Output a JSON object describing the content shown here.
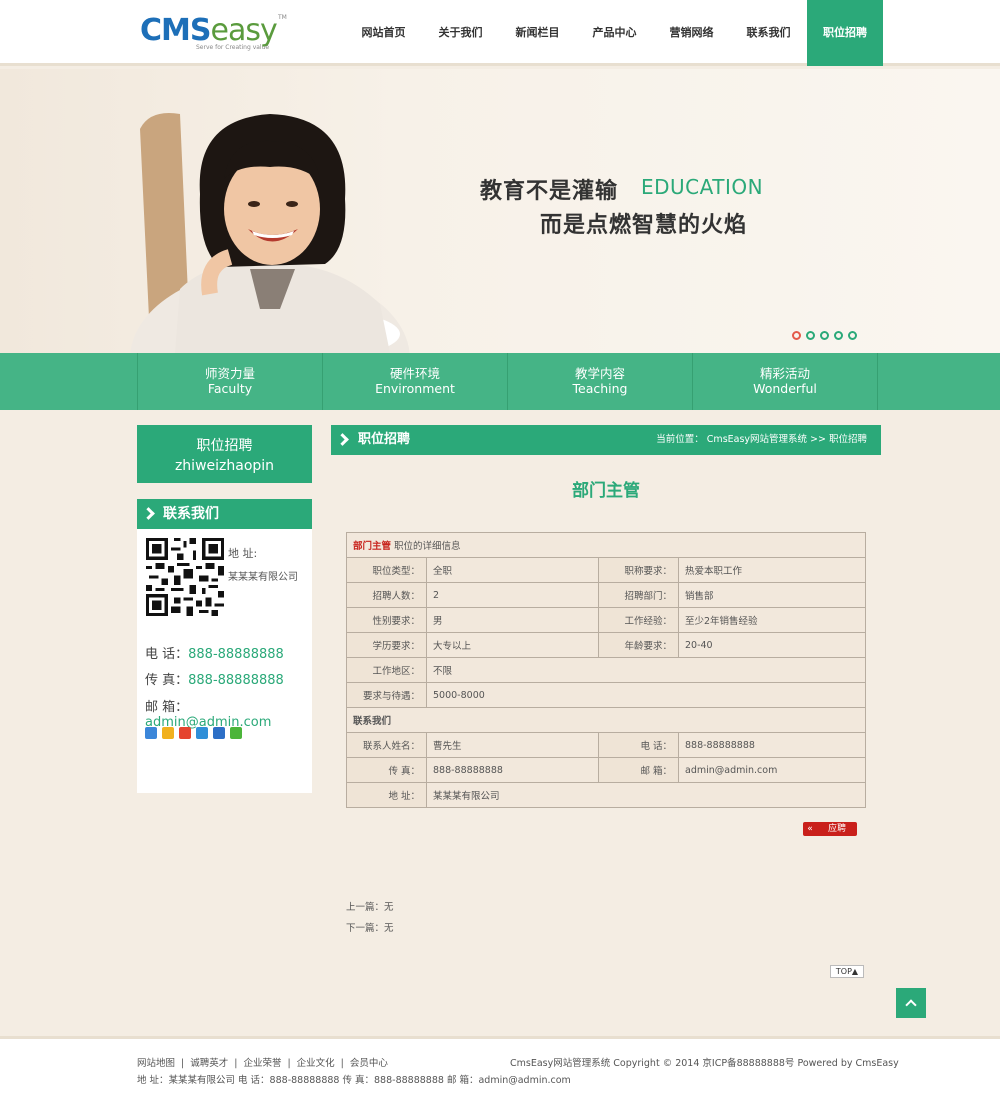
{
  "logo": {
    "cms": "CMS",
    "easy": "easy",
    "tm": "TM",
    "slogan": "Serve for Creating value"
  },
  "nav": [
    "网站首页",
    "关于我们",
    "新闻栏目",
    "产品中心",
    "营销网络",
    "联系我们",
    "职位招聘"
  ],
  "banner": {
    "line1": "教育不是灌输",
    "edu": "EDUCATION",
    "line2": "而是点燃智慧的火焰",
    "slides": 5,
    "active_slide": 1
  },
  "features": [
    {
      "cn": "师资力量",
      "en": "Faculty"
    },
    {
      "cn": "硬件环境",
      "en": "Environment"
    },
    {
      "cn": "教学内容",
      "en": "Teaching"
    },
    {
      "cn": "精彩活动",
      "en": "Wonderful"
    }
  ],
  "sidebar": {
    "cat_cn": "职位招聘",
    "cat_en": "zhiweizhaopin",
    "contact_title": "联系我们",
    "addr_label": "地 址:",
    "addr_value": "某某某有限公司",
    "phone_label": "电 话：",
    "phone": "888-88888888",
    "fax_label": "传 真：",
    "fax": "888-88888888",
    "email_label": "邮 箱：",
    "email": "admin@admin.com"
  },
  "main": {
    "title": "职位招聘",
    "crumb": "当前位置： CmsEasy网站管理系统  >>  职位招聘",
    "job_title": "部门主管",
    "detail_name": "部门主管",
    "detail_suffix": "职位的详细信息",
    "rows": [
      {
        "k1": "职位类型：",
        "v1": "全职",
        "k2": "职称要求：",
        "v2": "热爱本职工作"
      },
      {
        "k1": "招聘人数：",
        "v1": "2",
        "k2": "招聘部门：",
        "v2": "销售部"
      },
      {
        "k1": "性别要求：",
        "v1": "男",
        "k2": "工作经验：",
        "v2": "至少2年销售经验"
      },
      {
        "k1": "学历要求：",
        "v1": "大专以上",
        "k2": "年龄要求：",
        "v2": "20-40"
      }
    ],
    "area_k": "工作地区：",
    "area_v": "不限",
    "salary_k": "要求与待遇：",
    "salary_v": "5000-8000",
    "contact_section": "联系我们",
    "c_rows": [
      {
        "k1": "联系人姓名：",
        "v1": "曹先生",
        "k2": "电 话：",
        "v2": "888-88888888"
      },
      {
        "k1": "传 真：",
        "v1": "888-88888888",
        "k2": "邮 箱：",
        "v2": "admin@admin.com"
      }
    ],
    "c_addr_k": "地 址：",
    "c_addr_v": "某某某有限公司",
    "apply_arrow": "«",
    "apply_label": "应聘",
    "prev": "上一篇：无",
    "next": "下一篇：无",
    "top_label": "TOP▲"
  },
  "footer": {
    "links": [
      "网站地图",
      "诚聘英才",
      "企业荣誉",
      "企业文化",
      "会员中心"
    ],
    "sep": "|",
    "right": "CmsEasy网站管理系统  Copyright © 2014  京ICP备88888888号  Powered by CmsEasy",
    "addr": "地 址：某某某有限公司  电 话：888-88888888  传 真：888-88888888  邮 箱：admin@admin.com"
  },
  "colors": {
    "accent": "#2ba979",
    "feature_bar": "#45b486",
    "apply": "#c9201b",
    "bg": "#f4ede3"
  }
}
